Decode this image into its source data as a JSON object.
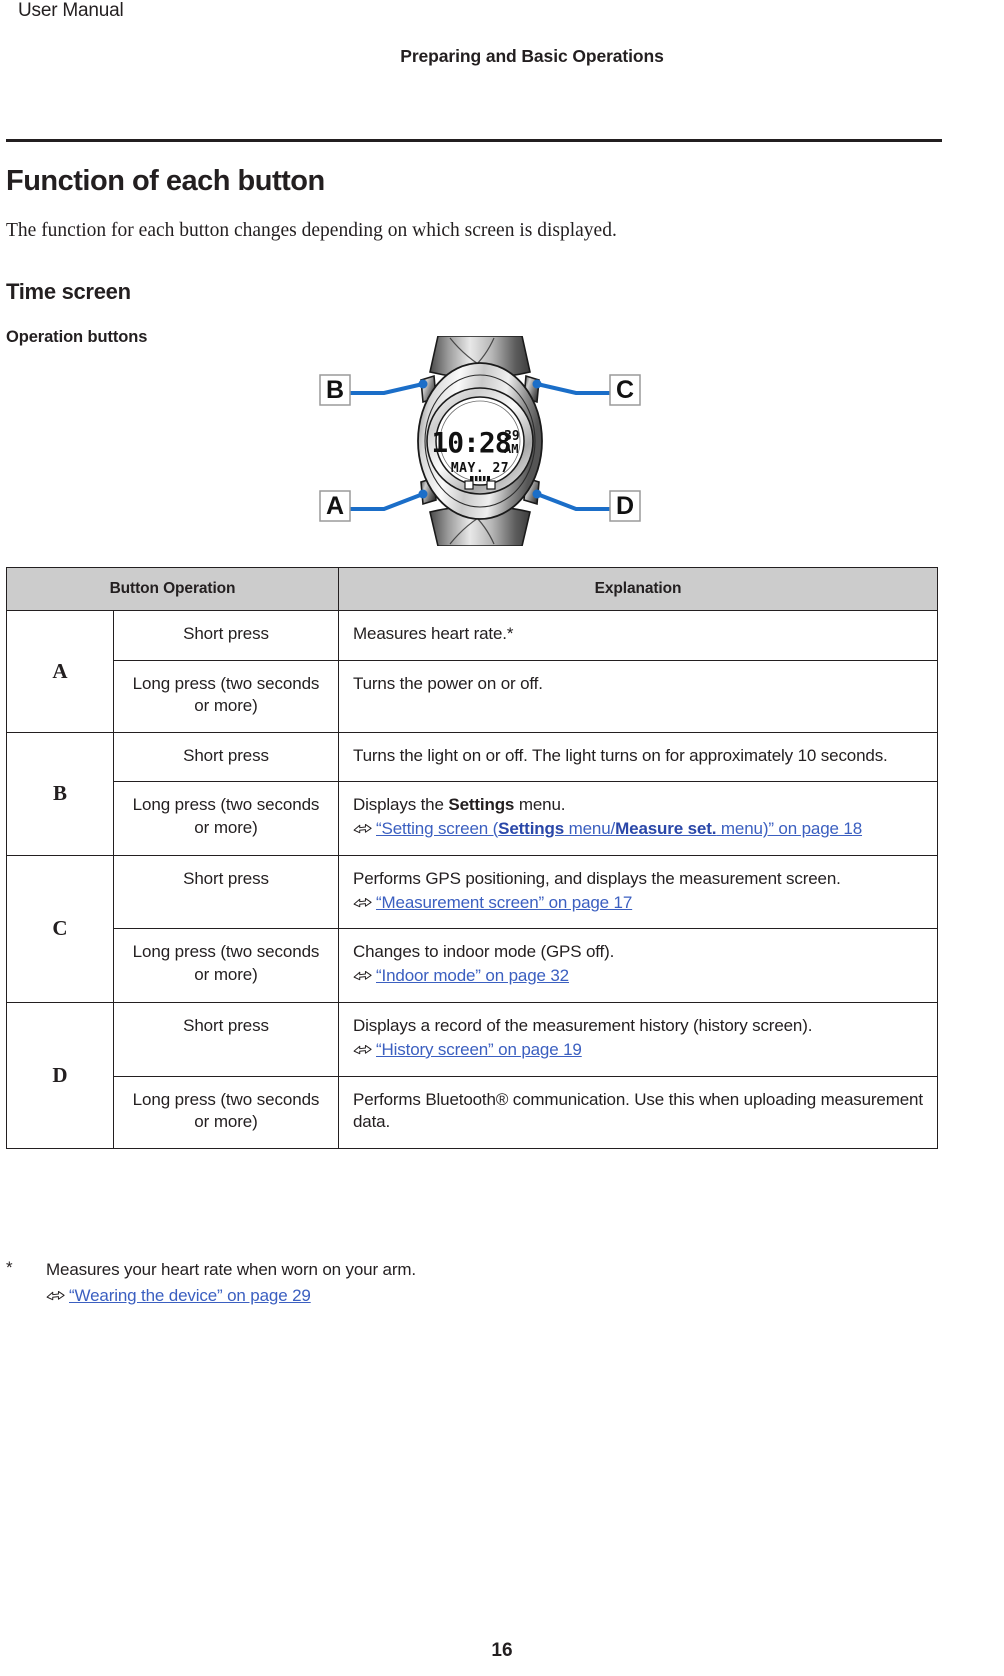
{
  "header": {
    "manual_label": "User Manual",
    "chapter_title": "Preparing and Basic Operations"
  },
  "content": {
    "h1": "Function of each button",
    "intro": "The function for each button changes depending on which screen is displayed.",
    "h2": "Time screen",
    "h3": "Operation buttons"
  },
  "figure": {
    "callouts": {
      "a": "A",
      "b": "B",
      "c": "C",
      "d": "D"
    },
    "watch_display": {
      "time": "10:28",
      "seconds": "39",
      "meridiem": "AM",
      "date": "MAY. 27"
    }
  },
  "table": {
    "headers": [
      "Button Operation",
      "Explanation"
    ],
    "rows": [
      {
        "button": "A",
        "operations": [
          {
            "op": "Short press",
            "text": "Measures heart rate.*",
            "link": null
          },
          {
            "op": "Long press (two seconds or more)",
            "text": "Turns the power on or off.",
            "link": null
          }
        ]
      },
      {
        "button": "B",
        "operations": [
          {
            "op": "Short press",
            "text": "Turns the light on or off. The light turns on for approximately 10 seconds.",
            "link": null
          },
          {
            "op": "Long press (two seconds or more)",
            "text": "Displays the Settings menu.",
            "text_pre": "Displays the ",
            "text_bold": "Settings",
            "text_post": " menu.",
            "link": {
              "pre": "“Setting screen (",
              "bold1": "Settings",
              "mid1": " menu/",
              "bold2": "Measure set.",
              "mid2": " menu)” on page 18"
            }
          }
        ]
      },
      {
        "button": "C",
        "operations": [
          {
            "op": "Short press",
            "text": "Performs GPS positioning, and displays the measurement screen.",
            "link": {
              "plain": "“Measurement screen” on page 17"
            }
          },
          {
            "op": "Long press (two seconds or more)",
            "text": "Changes to indoor mode (GPS off).",
            "link": {
              "plain": "“Indoor mode” on page 32"
            }
          }
        ]
      },
      {
        "button": "D",
        "operations": [
          {
            "op": "Short press",
            "text": "Displays a record of the measurement history (history screen).",
            "link": {
              "plain": "“History screen” on page 19"
            }
          },
          {
            "op": "Long press (two seconds or more)",
            "text": "Performs Bluetooth® communication. Use this when uploading measurement data.",
            "link": null
          }
        ]
      }
    ]
  },
  "footnote": {
    "mark": "*",
    "text": "Measures your heart rate when worn on your arm.",
    "link": "“Wearing the device” on page 29"
  },
  "page_number": "16",
  "colors": {
    "link": "#3b5fc0",
    "callout_line": "#1b6ec8",
    "header_fill": "#cccccc",
    "text": "#231f20"
  }
}
